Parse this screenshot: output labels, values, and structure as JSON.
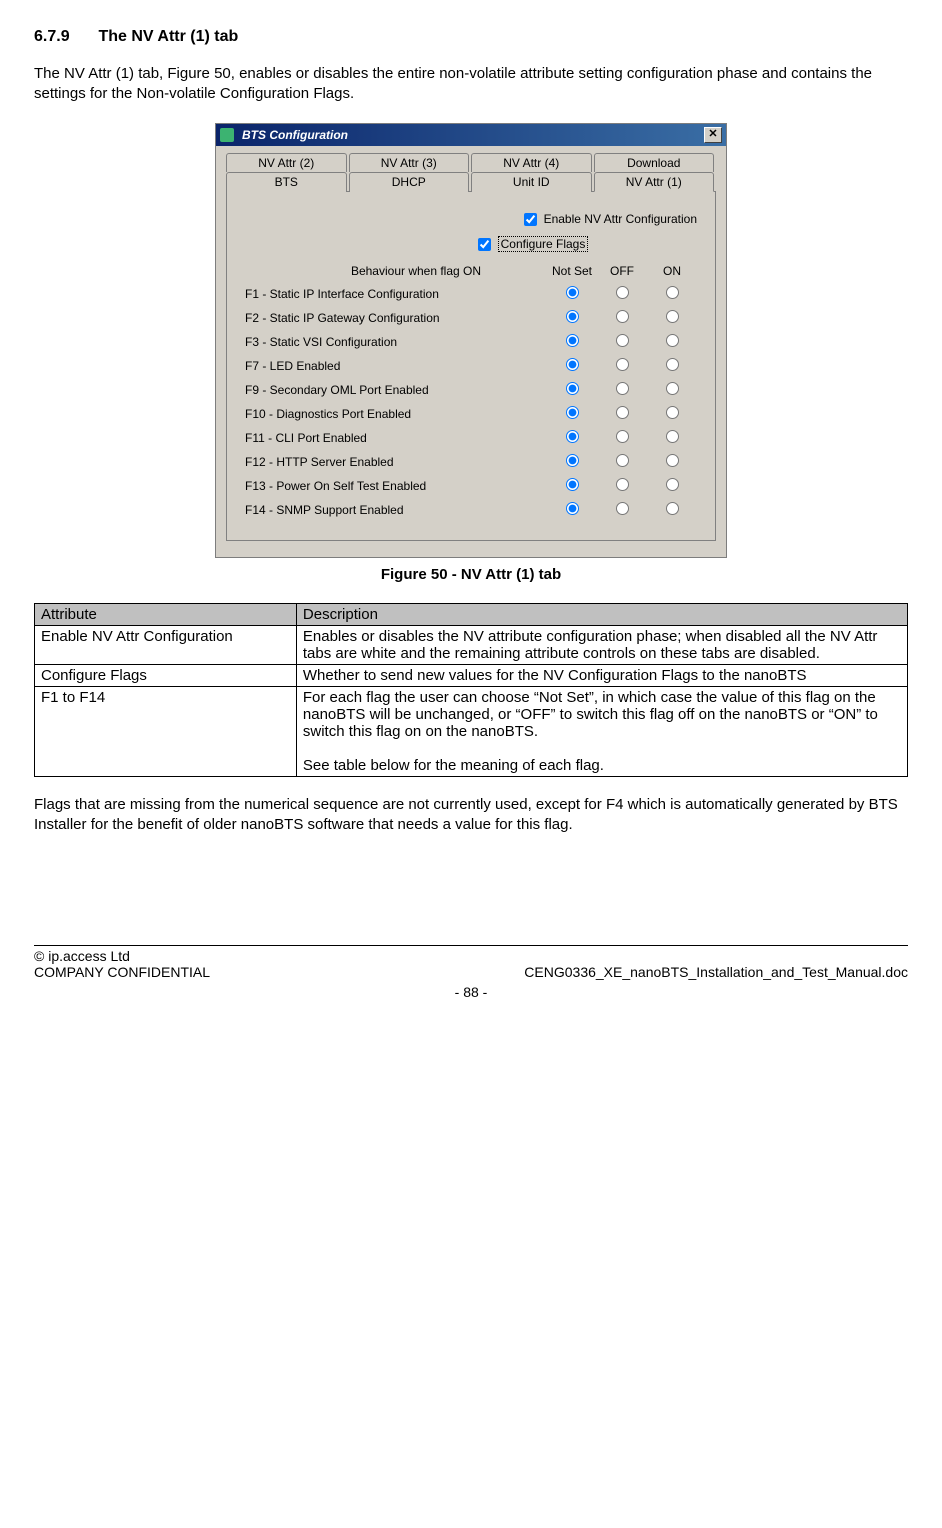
{
  "heading": {
    "number": "6.7.9",
    "title": "The NV Attr (1) tab"
  },
  "intro": "The NV Attr (1) tab, Figure 50, enables or disables the entire non-volatile attribute setting configuration phase and contains the settings for the Non-volatile Configuration Flags.",
  "dialog": {
    "title": "BTS Configuration",
    "close": "✕",
    "tabs_row1": [
      "NV Attr (2)",
      "NV Attr (3)",
      "NV Attr (4)",
      "Download"
    ],
    "tabs_row2": [
      "BTS",
      "DHCP",
      "Unit ID",
      "NV Attr (1)"
    ],
    "active_tab": "NV Attr (1)",
    "check1": "Enable NV Attr Configuration",
    "check2": "Configure Flags",
    "col_header_left": "Behaviour when flag ON",
    "cols": [
      "Not Set",
      "OFF",
      "ON"
    ],
    "flags": [
      "F1 - Static IP Interface Configuration",
      "F2 - Static IP Gateway Configuration",
      "F3 - Static VSI Configuration",
      "F7 - LED Enabled",
      "F9 - Secondary OML Port Enabled",
      "F10 - Diagnostics Port Enabled",
      "F11 - CLI Port Enabled",
      "F12 - HTTP Server Enabled",
      "F13 - Power On Self Test Enabled",
      "F14 - SNMP Support Enabled"
    ]
  },
  "figure_caption": "Figure 50 - NV Attr (1) tab",
  "table": {
    "headers": [
      "Attribute",
      "Description"
    ],
    "rows": [
      {
        "a": "Enable NV Attr Configuration",
        "d": "Enables or disables the NV attribute configuration phase; when disabled all the NV Attr tabs are white and the remaining attribute controls on these tabs are disabled."
      },
      {
        "a": "Configure Flags",
        "d": "Whether to send new values for the NV Configuration Flags to the nanoBTS"
      },
      {
        "a": "F1 to F14",
        "d": "For each flag the user can choose “Not Set”, in which case the value of this flag on the nanoBTS will be unchanged, or “OFF” to switch this flag off on the nanoBTS or “ON” to switch this flag on on the nanoBTS.\n\nSee table below for the meaning of each flag."
      }
    ]
  },
  "after_table": "Flags that are missing from the numerical sequence are not currently used, except for F4 which is automatically generated by BTS Installer for the benefit of older nanoBTS software that needs a value for this flag.",
  "footer": {
    "copyright": "© ip.access Ltd",
    "confidential": "COMPANY CONFIDENTIAL",
    "docname": "CENG0336_XE_nanoBTS_Installation_and_Test_Manual.doc",
    "pagenum": "- 88 -"
  }
}
